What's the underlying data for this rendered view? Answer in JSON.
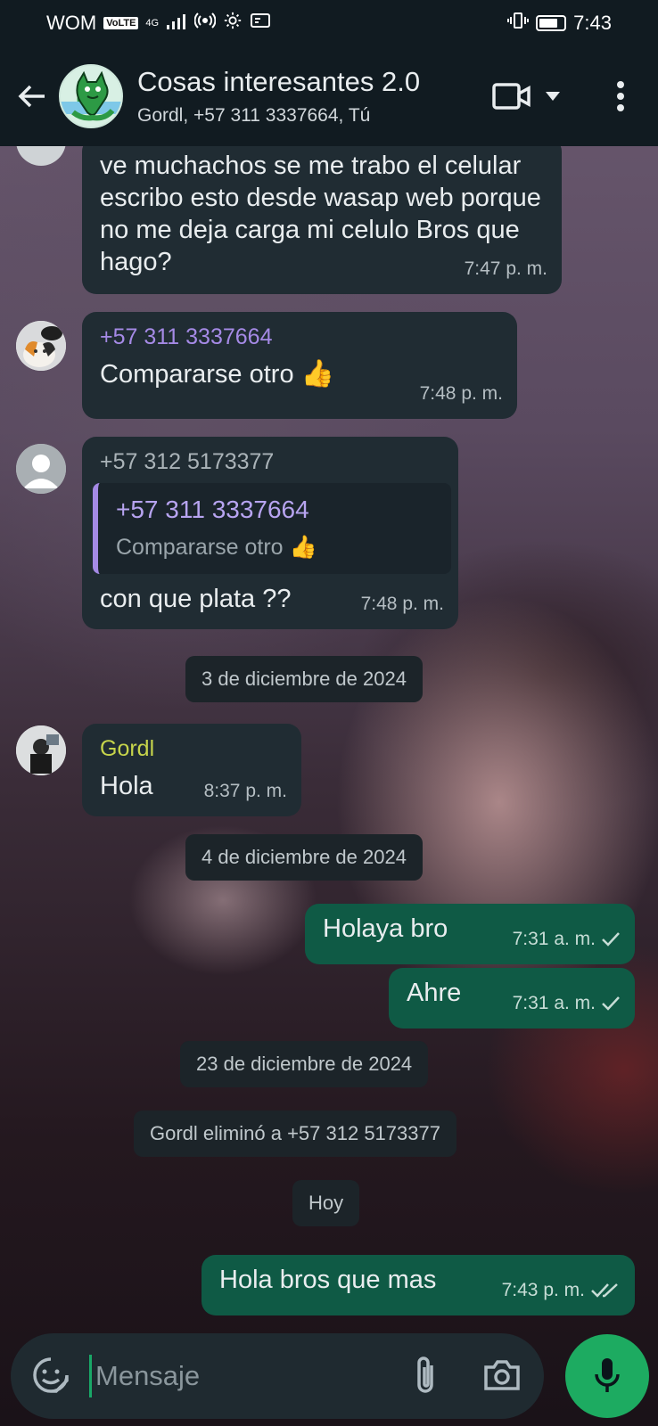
{
  "status_bar": {
    "carrier": "WOM",
    "volte": "VoLTE",
    "network": "4G",
    "battery_level": 0.75,
    "time": "7:43"
  },
  "header": {
    "title": "Cosas interesantes 2.0",
    "members": "Gordl, +57 311 3337664, Tú"
  },
  "messages": [
    {
      "direction": "in",
      "text": "ve muchachos se me trabo el celular escribo esto desde wasap web porque no me deja carga mi celulo Bros que hago?",
      "time": "7:47 p. m."
    },
    {
      "direction": "in",
      "sender": "+57 311 3337664",
      "sender_color": "#a58ae6",
      "text": "Compararse otro",
      "emoji": "👍",
      "time": "7:48 p. m."
    },
    {
      "direction": "in",
      "sender": "+57 312 5173377",
      "sender_color": "#aab3b8",
      "quote": {
        "sender": "+57 311 3337664",
        "text": "Compararse otro",
        "emoji": "👍"
      },
      "text": "con que plata ??",
      "time": "7:48 p. m."
    },
    {
      "direction": "in",
      "sender": "Gordl",
      "sender_color": "#c6d44b",
      "text": "Hola",
      "time": "8:37 p. m."
    },
    {
      "direction": "out",
      "text": "Holaya bro",
      "time": "7:31 a. m.",
      "status": "sent"
    },
    {
      "direction": "out",
      "text": "Ahre",
      "time": "7:31 a. m.",
      "status": "sent"
    },
    {
      "direction": "out",
      "text": "Hola bros que mas",
      "time": "7:43 p. m.",
      "status": "delivered"
    }
  ],
  "date_chips": [
    "3 de diciembre de 2024",
    "4 de diciembre de 2024",
    "23 de diciembre de 2024",
    "Hoy"
  ],
  "system_message": "Gordl eliminó a +57 312 5173377",
  "input": {
    "placeholder": "Mensaje"
  },
  "icons": {
    "back": "arrow-left-icon",
    "video": "video-call-icon",
    "dropdown": "chevron-down-icon",
    "menu": "more-vert-icon",
    "sticker": "sticker-icon",
    "attach": "paperclip-icon",
    "camera": "camera-icon",
    "mic": "microphone-icon"
  },
  "colors": {
    "outgoing_bubble": "#0f5a45",
    "incoming_bubble": "#202c33",
    "accent": "#1dab61",
    "header": "#111b21"
  }
}
